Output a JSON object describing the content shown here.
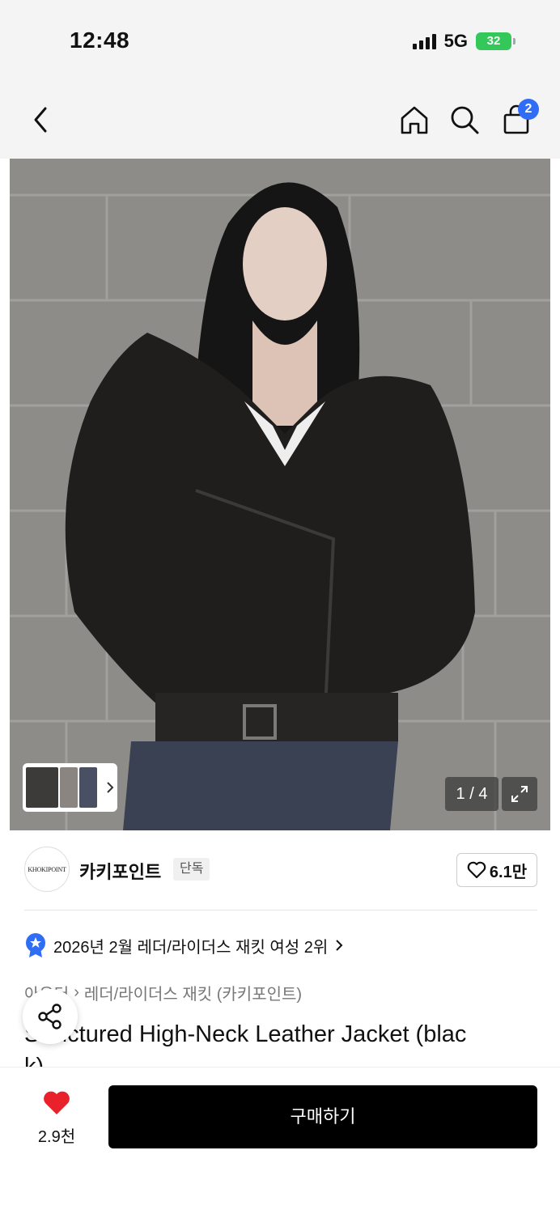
{
  "status_bar": {
    "time": "12:48",
    "network": "5G",
    "battery": "32"
  },
  "nav": {
    "bag_count": "2"
  },
  "gallery": {
    "counter": "1 / 4"
  },
  "brand": {
    "logo_text": "KHOKIPOINT",
    "name": "카키포인트",
    "tag": "단독",
    "likes": "6.1만"
  },
  "ranking": {
    "text": "2026년 2월 레더/라이더스 재킷 여성 2위"
  },
  "breadcrumb": {
    "parent": "아우터",
    "child": "레더/라이더스 재킷 (카키포인트)"
  },
  "product": {
    "title_line1": "Structured High-Neck Leather Jacket (blac",
    "title_line2": "k)"
  },
  "bottom": {
    "wish_count": "2.9천",
    "buy_label": "구매하기"
  },
  "colors": {
    "accent_blue": "#2f6df6",
    "heart_red": "#e8212b",
    "battery_green": "#34c759"
  },
  "icons": [
    "back-arrow",
    "home",
    "search",
    "shopping-bag",
    "expand",
    "heart",
    "share",
    "ranking-badge"
  ]
}
